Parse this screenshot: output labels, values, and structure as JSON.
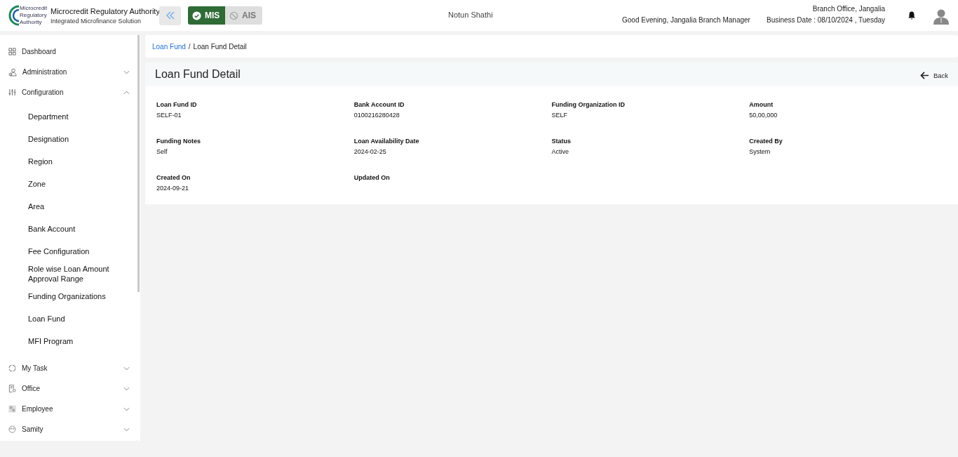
{
  "header": {
    "logo_text": "Microcredit Regulatory Authority",
    "org_name": "Microcredit Regulatory Authority",
    "org_subtitle": "Integrated Microfinance Solution",
    "modes": [
      {
        "label": "MIS",
        "selected": true
      },
      {
        "label": "AIS",
        "selected": false
      }
    ],
    "app_name": "Notun Shathi",
    "greeting": "Good Evening, Jangalia Branch Manager",
    "office": "Branch Office, Jangalia",
    "business_date": "Business Date : 08/10/2024 , Tuesday"
  },
  "sidebar": {
    "items": [
      {
        "label": "Dashboard",
        "kind": "link"
      },
      {
        "label": "Administration",
        "kind": "group",
        "expanded": false
      },
      {
        "label": "Configuration",
        "kind": "group",
        "expanded": true,
        "children": [
          {
            "label": "Department"
          },
          {
            "label": "Designation"
          },
          {
            "label": "Region"
          },
          {
            "label": "Zone"
          },
          {
            "label": "Area"
          },
          {
            "label": "Bank Account"
          },
          {
            "label": "Fee Configuration"
          },
          {
            "label": "Role wise Loan Amount Approval Range"
          },
          {
            "label": "Funding Organizations"
          },
          {
            "label": "Loan Fund"
          },
          {
            "label": "MFI Program"
          }
        ]
      },
      {
        "label": "My Task",
        "kind": "group",
        "expanded": false
      },
      {
        "label": "Office",
        "kind": "group",
        "expanded": false
      },
      {
        "label": "Employee",
        "kind": "group",
        "expanded": false
      },
      {
        "label": "Samity",
        "kind": "group",
        "expanded": false
      }
    ]
  },
  "breadcrumb": [
    {
      "label": "Loan Fund",
      "kind": "link"
    },
    {
      "label": "/",
      "kind": "separator"
    },
    {
      "label": "Loan Fund Detail",
      "kind": "current"
    }
  ],
  "detail": {
    "title": "Loan Fund Detail",
    "back": "Back",
    "fields": [
      {
        "label": "Loan Fund ID",
        "value": "SELF-01"
      },
      {
        "label": "Bank Account ID",
        "value": "0100216280428"
      },
      {
        "label": "Funding Organization ID",
        "value": "SELF"
      },
      {
        "label": "Amount",
        "value": "50,00,000"
      },
      {
        "label": "Funding Notes",
        "value": "Self"
      },
      {
        "label": "Loan Availability Date",
        "value": "2024-02-25"
      },
      {
        "label": "Status",
        "value": "Active"
      },
      {
        "label": "Created By",
        "value": "System"
      },
      {
        "label": "Created On",
        "value": "2024-09-21"
      },
      {
        "label": "Updated On"
      }
    ]
  }
}
